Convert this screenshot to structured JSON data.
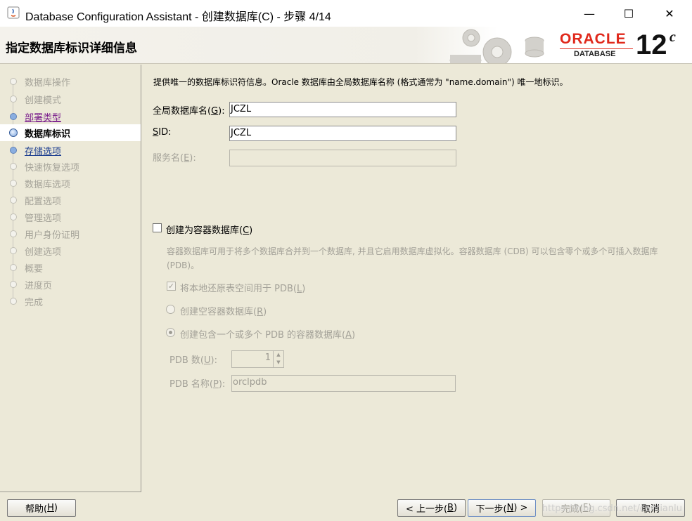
{
  "window": {
    "title": "Database Configuration Assistant - 创建数据库(C) - 步骤 4/14",
    "controls": {
      "minimize": "—",
      "maximize": "☐",
      "close": "✕"
    }
  },
  "header": {
    "title": "指定数据库标识详细信息",
    "logo": {
      "brand": "ORACLE",
      "sub": "DATABASE",
      "version": "12",
      "version_sup": "c"
    }
  },
  "nav": {
    "items": [
      {
        "label": "数据库操作",
        "state": "disabled"
      },
      {
        "label": "创建模式",
        "state": "disabled"
      },
      {
        "label": "部署类型",
        "state": "visited"
      },
      {
        "label": "数据库标识",
        "state": "active"
      },
      {
        "label": "存储选项",
        "state": "link"
      },
      {
        "label": "快速恢复选项",
        "state": "disabled"
      },
      {
        "label": "数据库选项",
        "state": "disabled"
      },
      {
        "label": "配置选项",
        "state": "disabled"
      },
      {
        "label": "管理选项",
        "state": "disabled"
      },
      {
        "label": "用户身份证明",
        "state": "disabled"
      },
      {
        "label": "创建选项",
        "state": "disabled"
      },
      {
        "label": "概要",
        "state": "disabled"
      },
      {
        "label": "进度页",
        "state": "disabled"
      },
      {
        "label": "完成",
        "state": "disabled"
      }
    ]
  },
  "form": {
    "intro": "提供唯一的数据库标识符信息。Oracle 数据库由全局数据库名称 (格式通常为 \"name.domain\") 唯一地标识。",
    "global_db_name": {
      "label_pre": "全局数据库名(",
      "mnemonic": "G",
      "label_post": "):",
      "value": "JCZL"
    },
    "sid": {
      "mnemonic": "S",
      "label_rest": "ID:",
      "value": "JCZL"
    },
    "service_name": {
      "label_pre": "服务名(",
      "mnemonic": "E",
      "label_post": "):",
      "value": ""
    },
    "container": {
      "label_pre": "创建为容器数据库(",
      "mnemonic": "C",
      "label_post": ")",
      "checked": false,
      "description": "容器数据库可用于将多个数据库合并到一个数据库, 并且它启用数据库虚拟化。容器数据库 (CDB) 可以包含零个或多个可插入数据库 (PDB)。",
      "use_local_undo": {
        "label_pre": "将本地还原表空间用于 PDB(",
        "mnemonic": "L",
        "label_post": ")",
        "checked": true
      },
      "empty_cdb": {
        "label_pre": "创建空容器数据库(",
        "mnemonic": "R",
        "label_post": ")",
        "selected": false
      },
      "cdb_with_pdbs": {
        "label_pre": "创建包含一个或多个 PDB 的容器数据库(",
        "mnemonic": "A",
        "label_post": ")",
        "selected": true
      },
      "pdb_count": {
        "label_pre": "PDB 数(",
        "mnemonic": "U",
        "label_post": "):",
        "value": "1"
      },
      "pdb_name": {
        "label_pre": "PDB 名称(",
        "mnemonic": "P",
        "label_post": "):",
        "value": "orclpdb"
      }
    }
  },
  "footer": {
    "help": {
      "pre": "帮助(",
      "mnemonic": "H",
      "post": ")"
    },
    "back": {
      "pre": "< 上一步(",
      "mnemonic": "B",
      "post": ")"
    },
    "next": {
      "pre": "下一步(",
      "mnemonic": "N",
      "post": ") >"
    },
    "finish": {
      "pre": "完成(",
      "mnemonic": "F",
      "post": ")"
    },
    "cancel": "取消"
  },
  "watermark": "https://blog.csdn.net/cantianlu"
}
